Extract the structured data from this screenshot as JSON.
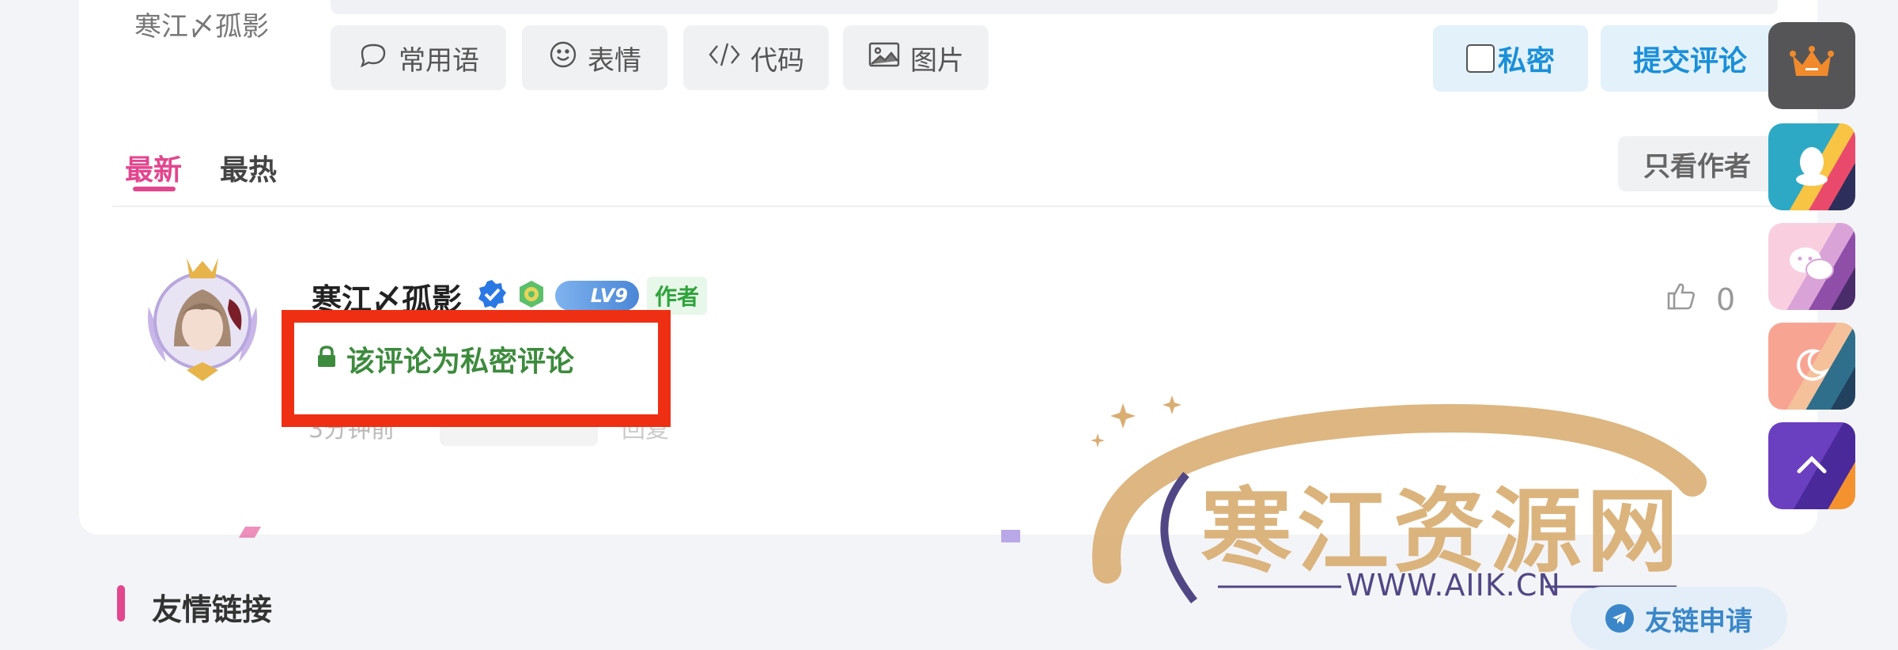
{
  "editor": {
    "top_user_name": "寒江〆孤影",
    "tools": [
      {
        "icon": "speech-bubble-icon",
        "label": "常用语"
      },
      {
        "icon": "smiley-icon",
        "label": "表情"
      },
      {
        "icon": "code-icon",
        "label": "代码"
      },
      {
        "icon": "image-icon",
        "label": "图片"
      }
    ],
    "private_label": "私密",
    "private_checked": false,
    "submit_label": "提交评论"
  },
  "tabs": {
    "newest": "最新",
    "hottest": "最热",
    "active": "最新",
    "author_only": "只看作者"
  },
  "comment": {
    "user_name": "寒江〆孤影",
    "level": "LV9",
    "author_tag": "作者",
    "private_notice": "该评论为私密评论",
    "like_count": "0",
    "meta_time": "3分钟前",
    "meta_reply": "回复"
  },
  "watermark": {
    "title": "寒江资源网",
    "url": "WWW.AIIK.CN"
  },
  "links": {
    "title": "友情链接",
    "apply_label": "友链申请"
  },
  "sidebar": [
    {
      "icon": "crown-icon"
    },
    {
      "icon": "qq-penguin-icon"
    },
    {
      "icon": "wechat-icon"
    },
    {
      "icon": "moon-icon"
    },
    {
      "icon": "chevron-up-icon"
    }
  ],
  "colors": {
    "accent_pink": "#e2468e",
    "accent_blue": "#1a8fd8",
    "private_green": "#3d8b3d",
    "highlight_red": "#ee2f14"
  }
}
